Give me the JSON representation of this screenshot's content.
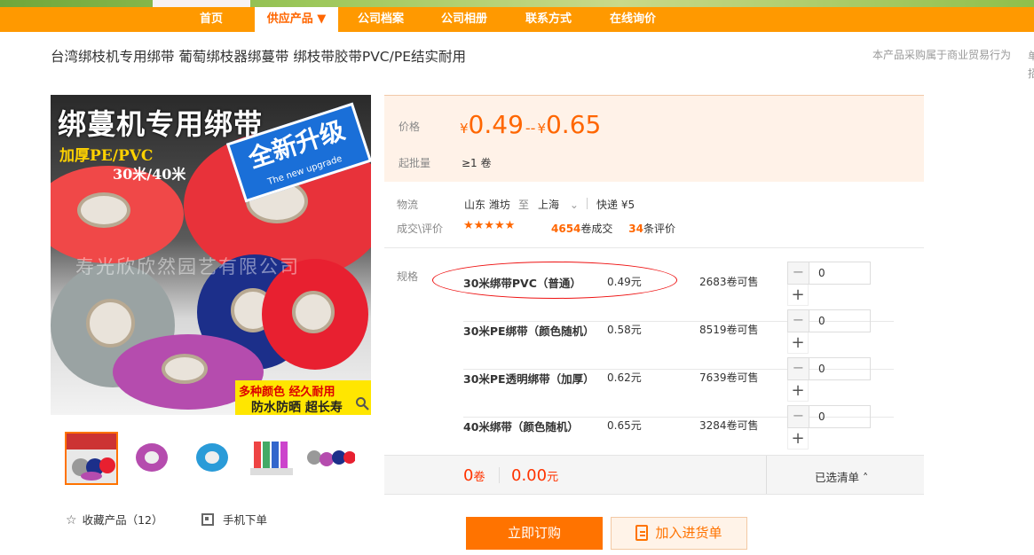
{
  "nav": {
    "items": [
      "首页",
      "供应产品 ▼",
      "公司档案",
      "公司相册",
      "联系方式",
      "在线询价"
    ],
    "active_index": 1
  },
  "product": {
    "title": "台湾绑枝机专用绑带 葡萄绑枝器绑蔓带 绑枝带胶带PVC/PE结实耐用",
    "note": "本产品采购属于商业贸易行为",
    "note_overflow": "单招"
  },
  "image": {
    "headline": "绑蔓机专用绑带",
    "sub1": "加厚PE/PVC",
    "sub2": "30米/40米",
    "badge": "全新升级",
    "badge_sub": "The new upgrade",
    "watermark": "寿光欣欣然园艺有限公司",
    "tag1": "多种颜色 经久耐用",
    "tag2": "防水防晒 超长寿",
    "zoom_icon": "search-icon"
  },
  "price": {
    "label": "价格",
    "currency": "¥",
    "min": "0.49",
    "sep": "--",
    "max": "0.65",
    "moq_label": "起批量",
    "moq": "≥1 卷"
  },
  "logistics": {
    "label": "物流",
    "from": "山东 潍坊",
    "to_word": "至",
    "to": "上海",
    "shipping": "快递 ¥5",
    "deals_label": "成交\\评价",
    "rating": "★★★★★",
    "deals_count": "4654",
    "deals_unit": "卷成交",
    "reviews_count": "34",
    "reviews_unit": "条评价"
  },
  "specs": {
    "label": "规格",
    "rows": [
      {
        "name": "30米绑带PVC（普通）",
        "price": "0.49元",
        "stock": "2683卷可售",
        "qty": "0"
      },
      {
        "name": "30米PE绑带（颜色随机）",
        "price": "0.58元",
        "stock": "8519卷可售",
        "qty": "0"
      },
      {
        "name": "30米PE透明绑带（加厚）",
        "price": "0.62元",
        "stock": "7639卷可售",
        "qty": "0"
      },
      {
        "name": "40米绑带（颜色随机）",
        "price": "0.65元",
        "stock": "3284卷可售",
        "qty": "0"
      }
    ]
  },
  "summary": {
    "qty": "0",
    "qty_unit": "卷",
    "total": "0.00",
    "total_unit": "元",
    "selected_label": "已选清单 ˄"
  },
  "actions": {
    "favorite": "收藏产品（12）",
    "mobile": "手机下单",
    "order": "立即订购",
    "cart": "加入进货单"
  },
  "colors": {
    "accent": "#ff6600",
    "nav": "#ff9900",
    "highlight_oval": "#ee1111"
  }
}
